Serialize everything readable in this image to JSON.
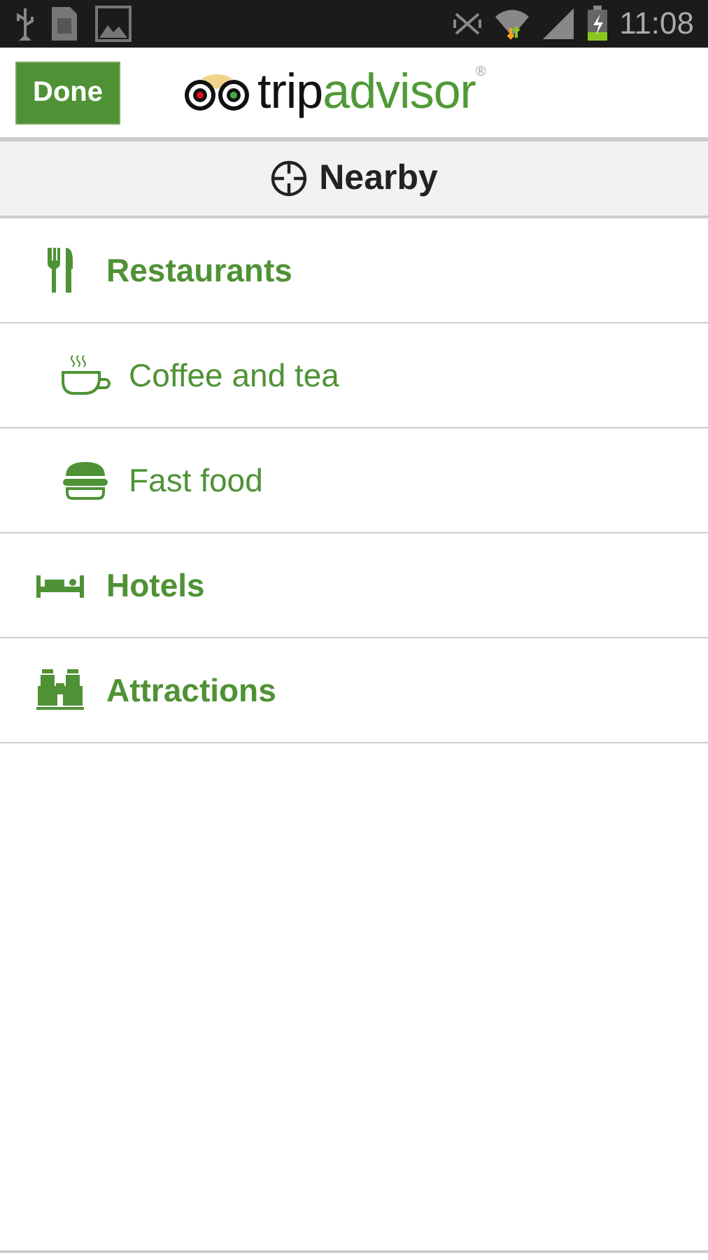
{
  "status_bar": {
    "time": "11:08"
  },
  "header": {
    "done_button": "Done",
    "logo": {
      "dark_part": "trip",
      "green_part": "advisor",
      "mark": "®"
    }
  },
  "section": {
    "title": "Nearby"
  },
  "items": [
    {
      "label": "Restaurants",
      "kind": "category"
    },
    {
      "label": "Coffee and tea",
      "kind": "subcategory"
    },
    {
      "label": "Fast food",
      "kind": "subcategory"
    },
    {
      "label": "Hotels",
      "kind": "category"
    },
    {
      "label": "Attractions",
      "kind": "category"
    }
  ]
}
